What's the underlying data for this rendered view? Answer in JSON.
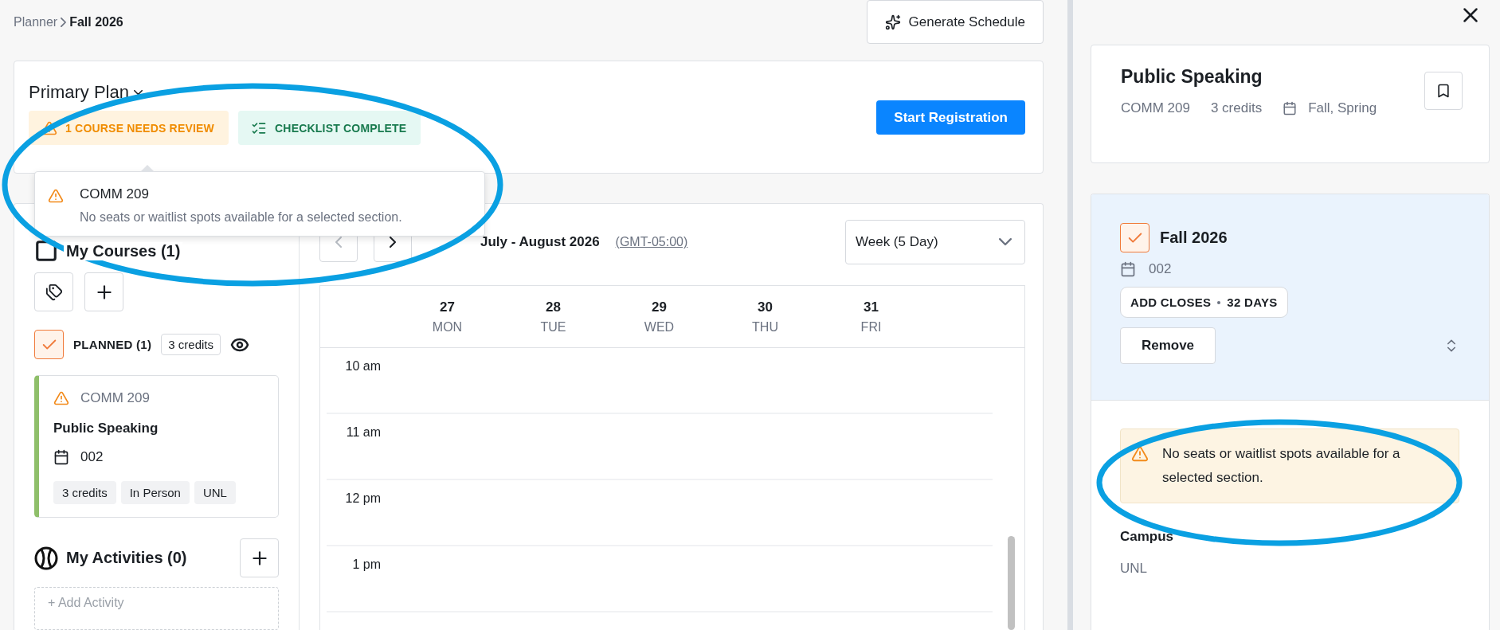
{
  "breadcrumb": {
    "parent": "Planner",
    "current": "Fall 2026"
  },
  "generate_button": "Generate Schedule",
  "plan": {
    "title": "Primary Plan",
    "badges": [
      {
        "kind": "warning",
        "label": "1 COURSE NEEDS REVIEW"
      },
      {
        "kind": "success",
        "label": "CHECKLIST COMPLETE"
      }
    ],
    "register_button": "Start Registration",
    "popover": {
      "code": "COMM 209",
      "message": "No seats or waitlist spots available for a selected section."
    }
  },
  "courses": {
    "title": "My Courses (1)",
    "groups": [
      {
        "label": "PLANNED (1)",
        "checked": true,
        "credits": "3 credits",
        "items": [
          {
            "code": "COMM 209",
            "warning": true,
            "title": "Public Speaking",
            "section": "002",
            "color": "#8fbf6a",
            "tags": [
              "3 credits",
              "In Person",
              "UNL"
            ]
          }
        ]
      }
    ]
  },
  "activities": {
    "title": "My Activities (0)",
    "add": "+ Add Activity"
  },
  "calendar": {
    "range": "July - August 2026",
    "timezone": "(GMT-05:00)",
    "view": "Week (5 Day)",
    "days": [
      {
        "date": "27",
        "day": "MON"
      },
      {
        "date": "28",
        "day": "TUE"
      },
      {
        "date": "29",
        "day": "WED"
      },
      {
        "date": "30",
        "day": "THU"
      },
      {
        "date": "31",
        "day": "FRI"
      }
    ],
    "times": [
      "10 am",
      "11 am",
      "12 pm",
      "1 pm"
    ]
  },
  "detail": {
    "title": "Public Speaking",
    "code": "COMM 209",
    "credits": "3 credits",
    "terms": "Fall, Spring",
    "section": {
      "term": "Fall 2026",
      "checked": true,
      "number": "002",
      "deadline": "ADD CLOSES",
      "deadline_value": "32 DAYS",
      "remove": "Remove"
    },
    "warning": "No seats or waitlist spots available for a selected section.",
    "fields": [
      {
        "label": "Campus",
        "value": "UNL"
      }
    ]
  },
  "annotations": [
    {
      "kind": "ellipse"
    },
    {
      "kind": "ellipse"
    }
  ]
}
